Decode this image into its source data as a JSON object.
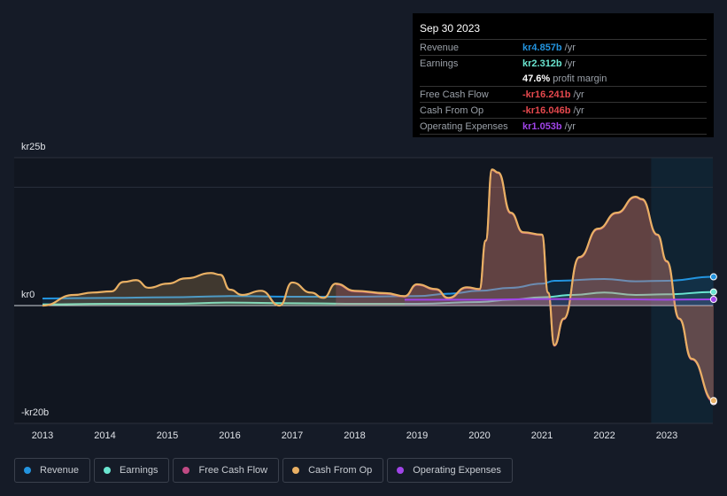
{
  "tooltip": {
    "date": "Sep 30 2023",
    "rows": [
      {
        "label": "Revenue",
        "value": "kr4.857b",
        "unit": "/yr",
        "color": "#2394df"
      },
      {
        "label": "Earnings",
        "value": "kr2.312b",
        "unit": "/yr",
        "color": "#6ae5d0"
      },
      {
        "label": "",
        "value": "47.6%",
        "unit": "profit margin",
        "color": "#ffffff"
      },
      {
        "label": "Free Cash Flow",
        "value": "-kr16.241b",
        "unit": "/yr",
        "color": "#e5484d"
      },
      {
        "label": "Cash From Op",
        "value": "-kr16.046b",
        "unit": "/yr",
        "color": "#e5484d"
      },
      {
        "label": "Operating Expenses",
        "value": "kr1.053b",
        "unit": "/yr",
        "color": "#a044e8"
      }
    ]
  },
  "chart_data": {
    "type": "area",
    "ylim": [
      -20,
      25
    ],
    "xlim": [
      2012.6,
      2023.75
    ],
    "y_tick_labels": [
      "kr25b",
      "kr0",
      "-kr20b"
    ],
    "y_ticks": [
      25,
      0,
      -20
    ],
    "x_tick_labels": [
      "2013",
      "2014",
      "2015",
      "2016",
      "2017",
      "2018",
      "2019",
      "2020",
      "2021",
      "2022",
      "2023"
    ],
    "forecast_shade_start": 2022.75,
    "series": [
      {
        "name": "Revenue",
        "color": "#2394df",
        "points": [
          [
            2013,
            1.2
          ],
          [
            2014,
            1.3
          ],
          [
            2015,
            1.4
          ],
          [
            2016,
            1.6
          ],
          [
            2017,
            1.5
          ],
          [
            2018,
            1.5
          ],
          [
            2019,
            1.6
          ],
          [
            2019.5,
            2.0
          ],
          [
            2020,
            2.5
          ],
          [
            2020.5,
            3.0
          ],
          [
            2021,
            3.7
          ],
          [
            2021.2,
            4.2
          ],
          [
            2022,
            4.5
          ],
          [
            2022.5,
            4.1
          ],
          [
            2023,
            4.2
          ],
          [
            2023.75,
            4.86
          ]
        ]
      },
      {
        "name": "Earnings",
        "color": "#6ae5d0",
        "points": [
          [
            2013,
            0.2
          ],
          [
            2014,
            0.3
          ],
          [
            2015,
            0.3
          ],
          [
            2016,
            0.5
          ],
          [
            2017,
            0.4
          ],
          [
            2018,
            0.3
          ],
          [
            2019,
            0.3
          ],
          [
            2020,
            0.6
          ],
          [
            2020.5,
            1.0
          ],
          [
            2021,
            1.4
          ],
          [
            2021.5,
            1.8
          ],
          [
            2022,
            2.2
          ],
          [
            2022.5,
            1.8
          ],
          [
            2023,
            1.9
          ],
          [
            2023.75,
            2.31
          ]
        ]
      },
      {
        "name": "Free Cash Flow",
        "color": "#c04a84",
        "points": [
          [
            2017.7,
            3.6
          ],
          [
            2018,
            2.4
          ],
          [
            2018.5,
            2.0
          ],
          [
            2018.8,
            1.5
          ],
          [
            2019,
            3.5
          ],
          [
            2019.3,
            2.7
          ],
          [
            2019.5,
            1.2
          ],
          [
            2019.8,
            3.0
          ],
          [
            2020,
            2.7
          ],
          [
            2020.1,
            10.9
          ],
          [
            2020.2,
            22.9
          ],
          [
            2020.3,
            22.4
          ],
          [
            2020.5,
            15.6
          ],
          [
            2020.7,
            12.3
          ],
          [
            2021,
            11.9
          ],
          [
            2021.1,
            2.1
          ],
          [
            2021.2,
            -6.8
          ],
          [
            2021.35,
            -2.3
          ],
          [
            2021.6,
            8.1
          ],
          [
            2021.9,
            12.9
          ],
          [
            2022.2,
            15.6
          ],
          [
            2022.5,
            18.3
          ],
          [
            2022.6,
            17.9
          ],
          [
            2022.85,
            11.9
          ],
          [
            2023,
            7.4
          ],
          [
            2023.2,
            -2.3
          ],
          [
            2023.4,
            -9.1
          ],
          [
            2023.75,
            -16.24
          ]
        ]
      },
      {
        "name": "Cash From Op",
        "color": "#e9b064",
        "points": [
          [
            2013,
            0
          ],
          [
            2013.5,
            1.8
          ],
          [
            2013.8,
            2.2
          ],
          [
            2014.1,
            2.4
          ],
          [
            2014.3,
            4.0
          ],
          [
            2014.5,
            4.3
          ],
          [
            2014.7,
            3.0
          ],
          [
            2015,
            3.7
          ],
          [
            2015.3,
            4.6
          ],
          [
            2015.7,
            5.5
          ],
          [
            2015.85,
            5.2
          ],
          [
            2016,
            2.7
          ],
          [
            2016.2,
            1.8
          ],
          [
            2016.5,
            2.5
          ],
          [
            2016.8,
            0
          ],
          [
            2017,
            3.9
          ],
          [
            2017.3,
            2.2
          ],
          [
            2017.5,
            1.3
          ],
          [
            2017.7,
            3.7
          ],
          [
            2018,
            2.5
          ],
          [
            2018.5,
            2.1
          ],
          [
            2018.8,
            1.6
          ],
          [
            2019,
            3.6
          ],
          [
            2019.3,
            2.8
          ],
          [
            2019.5,
            1.3
          ],
          [
            2019.8,
            3.1
          ],
          [
            2020,
            2.8
          ],
          [
            2020.1,
            11
          ],
          [
            2020.2,
            23
          ],
          [
            2020.3,
            22.5
          ],
          [
            2020.5,
            15.7
          ],
          [
            2020.7,
            12.4
          ],
          [
            2021,
            12
          ],
          [
            2021.1,
            2.2
          ],
          [
            2021.2,
            -6.7
          ],
          [
            2021.35,
            -2.2
          ],
          [
            2021.6,
            8.2
          ],
          [
            2021.9,
            13
          ],
          [
            2022.2,
            15.7
          ],
          [
            2022.5,
            18.4
          ],
          [
            2022.6,
            18
          ],
          [
            2022.85,
            12
          ],
          [
            2023,
            7.5
          ],
          [
            2023.2,
            -2.2
          ],
          [
            2023.4,
            -9
          ],
          [
            2023.75,
            -16.05
          ]
        ]
      },
      {
        "name": "Operating Expenses",
        "color": "#a044e8",
        "points": [
          [
            2018.8,
            1.0
          ],
          [
            2019.5,
            1.0
          ],
          [
            2020,
            1.0
          ],
          [
            2021,
            1.1
          ],
          [
            2022,
            1.1
          ],
          [
            2023,
            1.0
          ],
          [
            2023.75,
            1.05
          ]
        ]
      }
    ]
  },
  "legend": [
    "Revenue",
    "Earnings",
    "Free Cash Flow",
    "Cash From Op",
    "Operating Expenses"
  ]
}
